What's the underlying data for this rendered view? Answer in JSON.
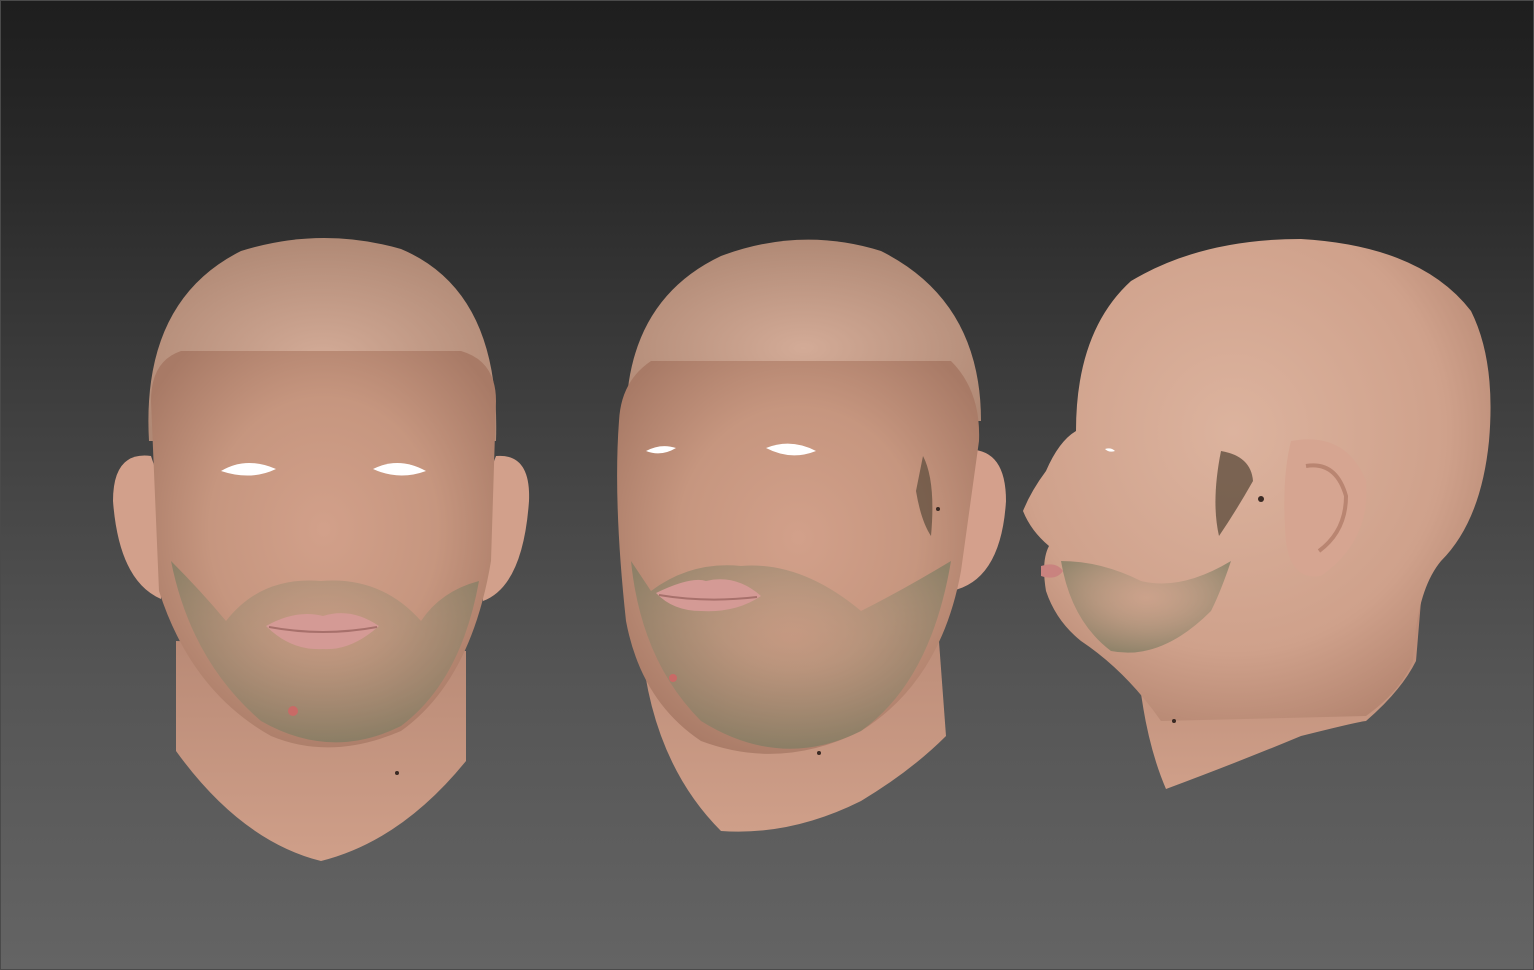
{
  "viewport": {
    "background_top": "#1e1e1e",
    "background_bottom": "#646464"
  },
  "models": [
    {
      "view": "front",
      "icon": "head-model-front"
    },
    {
      "view": "three-quarter",
      "icon": "head-model-three-quarter"
    },
    {
      "view": "side",
      "icon": "head-model-profile"
    }
  ],
  "colors": {
    "skin": "#c79a86",
    "skin_light": "#d8ad98",
    "skin_shadow": "#a97a66",
    "stubble": "#8e8a6e",
    "lips": "#c98a86",
    "eye_hole": "#ffffff"
  }
}
